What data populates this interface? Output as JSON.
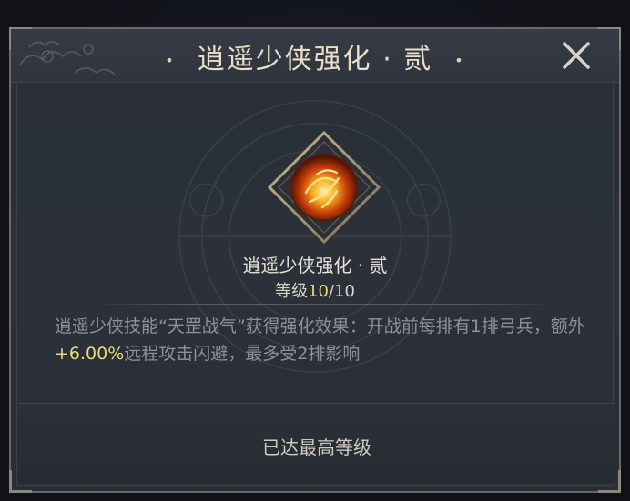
{
  "dialog": {
    "title": "逍遥少侠强化 · 贰",
    "title_dot_left": "•",
    "title_dot_right": "•"
  },
  "skill": {
    "name": "逍遥少侠强化 · 贰",
    "level_label": "等级",
    "level_current": "10",
    "level_separator": "/",
    "level_max": "10",
    "icon": "flame-swirl-icon"
  },
  "description": {
    "part1": "逍遥少侠技能“天罡战气”获得强化效果：开战前每排有1排弓兵，额外",
    "highlight": "+6.00%",
    "part2": "远程攻击闪避，最多受2排影响"
  },
  "footer": {
    "status": "已达最高等级"
  },
  "colors": {
    "accent_yellow": "#e9d96c",
    "panel_bg": "#2a2f38",
    "border": "#6b6a66"
  }
}
